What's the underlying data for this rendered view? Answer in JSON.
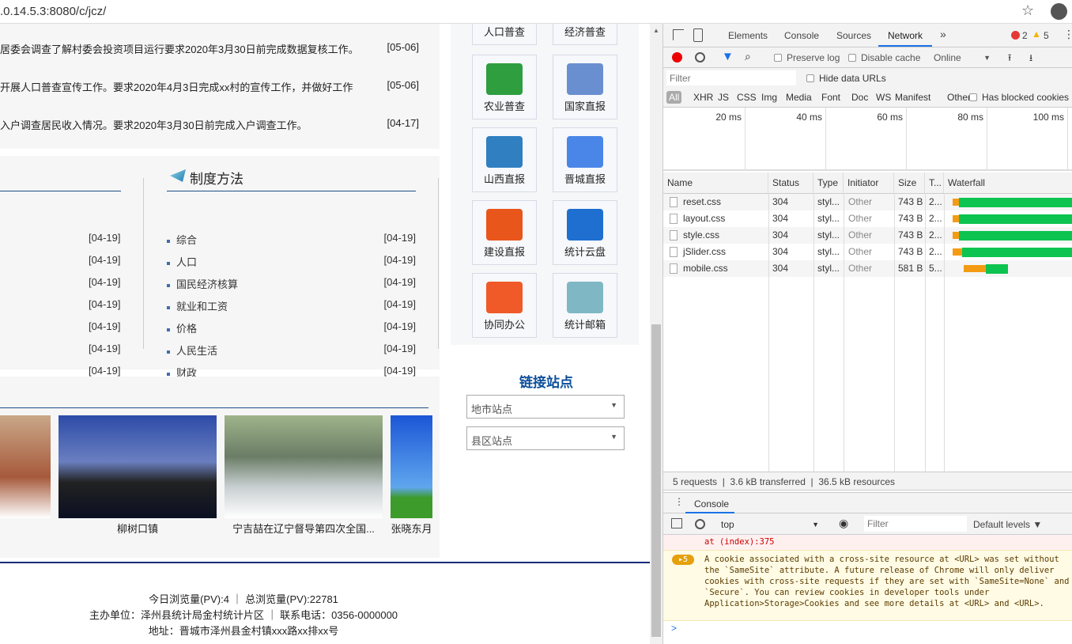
{
  "browser": {
    "url": ".0.14.5.3:8080/c/jcz/"
  },
  "news": [
    {
      "text": "居委会调查了解村委会投资项目运行要求2020年3月30日前完成数据复核工作。",
      "date": "[05-06]"
    },
    {
      "text": "开展人口普查宣传工作。要求2020年4月3日完成xx村的宣传工作，并做好工作",
      "date": "[05-06]"
    },
    {
      "text": "入户调查居民收入情况。要求2020年3月30日前完成入户调查工作。",
      "date": "[04-17]"
    }
  ],
  "left_dates": [
    "[04-19]",
    "[04-19]",
    "[04-19]",
    "[04-19]",
    "[04-19]",
    "[04-19]",
    "[04-19]"
  ],
  "methods": {
    "title": "制度方法",
    "items": [
      {
        "label": "综合",
        "date": "[04-19]"
      },
      {
        "label": "人口",
        "date": "[04-19]"
      },
      {
        "label": "国民经济核算",
        "date": "[04-19]"
      },
      {
        "label": "就业和工资",
        "date": "[04-19]"
      },
      {
        "label": "价格",
        "date": "[04-19]"
      },
      {
        "label": "人民生活",
        "date": "[04-19]"
      },
      {
        "label": "财政",
        "date": "[04-19]"
      }
    ]
  },
  "tiles": [
    {
      "label": "人口普查",
      "color": "#e07b39"
    },
    {
      "label": "经济普查",
      "color": "#3b7dd8"
    },
    {
      "label": "农业普查",
      "color": "#2e9e3e"
    },
    {
      "label": "国家直报",
      "color": "#6a8fd0"
    },
    {
      "label": "山西直报",
      "color": "#2f7fc1"
    },
    {
      "label": "晋城直报",
      "color": "#4a86e8"
    },
    {
      "label": "建设直报",
      "color": "#e8561c"
    },
    {
      "label": "统计云盘",
      "color": "#1e6fd0"
    },
    {
      "label": "协同办公",
      "color": "#f05a28"
    },
    {
      "label": "统计邮箱",
      "color": "#7fb8c4"
    }
  ],
  "links": {
    "title": "链接站点",
    "selects": [
      "地市站点",
      "县区站点"
    ]
  },
  "gallery": [
    {
      "caption": ""
    },
    {
      "caption": "柳树口镇"
    },
    {
      "caption": "宁吉喆在辽宁督导第四次全国..."
    },
    {
      "caption": "张晓东月"
    }
  ],
  "footer": [
    "今日浏览量(PV):4 ｜ 总浏览量(PV):22781",
    "主办单位：泽州县统计局金村统计片区 ｜ 联系电话：0356-0000000",
    "地址：晋城市泽州县金村镇xxx路xx排xx号"
  ],
  "devtools": {
    "tabs": [
      "Elements",
      "Console",
      "Sources",
      "Network"
    ],
    "active_tab": "Network",
    "errors": "2",
    "warnings": "5",
    "preserve_log": "Preserve log",
    "disable_cache": "Disable cache",
    "throttle": "Online",
    "filter_placeholder": "Filter",
    "hide_data_urls": "Hide data URLs",
    "types": [
      "All",
      "XHR",
      "JS",
      "CSS",
      "Img",
      "Media",
      "Font",
      "Doc",
      "WS",
      "Manifest",
      "Other"
    ],
    "blocked": "Has blocked cookies",
    "ticks": [
      "20 ms",
      "40 ms",
      "60 ms",
      "80 ms",
      "100 ms"
    ],
    "columns": [
      "Name",
      "Status",
      "Type",
      "Initiator",
      "Size",
      "T...",
      "Waterfall"
    ],
    "requests": [
      {
        "name": "reset.css",
        "status": "304",
        "type": "styl...",
        "initiator": "Other",
        "size": "743 B",
        "time": "2..."
      },
      {
        "name": "layout.css",
        "status": "304",
        "type": "styl...",
        "initiator": "Other",
        "size": "743 B",
        "time": "2..."
      },
      {
        "name": "style.css",
        "status": "304",
        "type": "styl...",
        "initiator": "Other",
        "size": "743 B",
        "time": "2..."
      },
      {
        "name": "jSlider.css",
        "status": "304",
        "type": "styl...",
        "initiator": "Other",
        "size": "743 B",
        "time": "2..."
      },
      {
        "name": "mobile.css",
        "status": "304",
        "type": "styl...",
        "initiator": "Other",
        "size": "581 B",
        "time": "5..."
      }
    ],
    "summary": [
      "5 requests",
      "3.6 kB transferred",
      "36.5 kB resources"
    ],
    "console": {
      "tab": "Console",
      "context": "top",
      "filter_placeholder": "Filter",
      "levels": "Default levels ▼",
      "error_tail": "at (index):375",
      "warn_count": "5",
      "warn_text": "A cookie associated with a cross-site resource at <URL> was set without the `SameSite` attribute. A future release of Chrome will only deliver cookies with cross-site requests if they are set with `SameSite=None` and `Secure`. You can review cookies in developer tools under Application>Storage>Cookies and see more details at <URL> and <URL>.",
      "prompt": ">"
    }
  }
}
